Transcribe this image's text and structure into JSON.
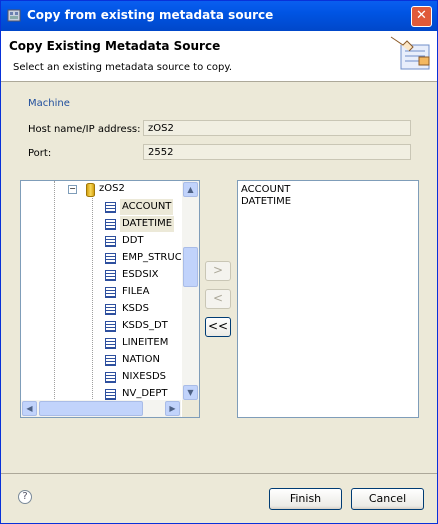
{
  "window": {
    "title": "Copy from existing metadata source",
    "close_icon": "close-icon"
  },
  "header": {
    "title": "Copy Existing Metadata Source",
    "subtitle": "Select an existing metadata source to copy."
  },
  "machine": {
    "section_label": "Machine",
    "host_label": "Host name/IP address:",
    "host_value": "zOS2",
    "port_label": "Port:",
    "port_value": "2552"
  },
  "tree": {
    "root": "zOS2",
    "items": [
      "ACCOUNT",
      "DATETIME",
      "DDT",
      "EMP_STRUC",
      "ESDSIX",
      "FILEA",
      "KSDS",
      "KSDS_DT",
      "LINEITEM",
      "NATION",
      "NIXESDS",
      "NV_DEPT"
    ],
    "selected": [
      "ACCOUNT",
      "DATETIME"
    ]
  },
  "move_buttons": {
    "add": ">",
    "remove": "<",
    "remove_all": "<<"
  },
  "selected_list": [
    "ACCOUNT",
    "DATETIME"
  ],
  "footer": {
    "finish": "Finish",
    "cancel": "Cancel",
    "help_icon": "help-icon"
  },
  "colors": {
    "titlebar": "#0054e3",
    "dialog_bg": "#ece9d8",
    "accent_text": "#1f4e9d"
  }
}
